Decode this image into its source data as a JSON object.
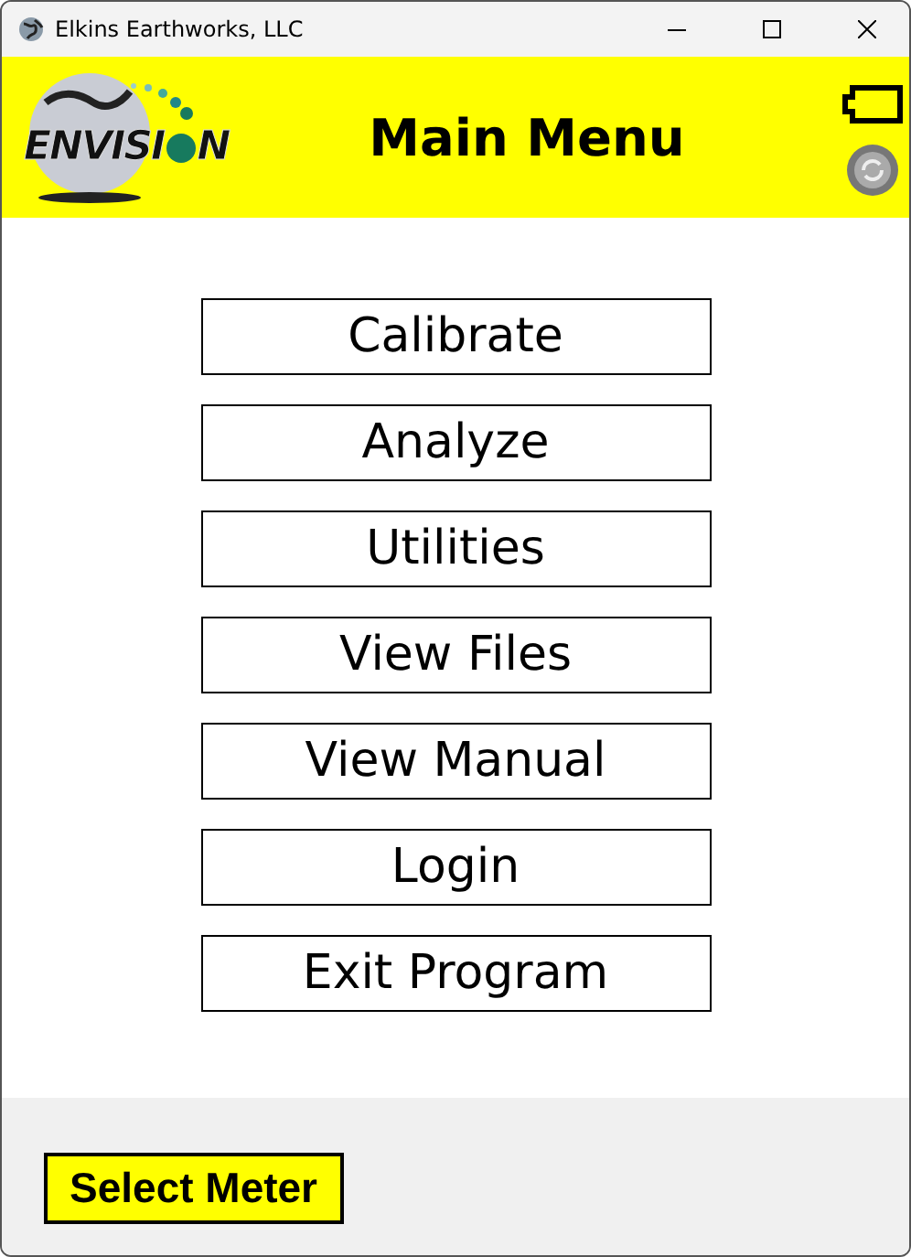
{
  "window": {
    "title": "Elkins Earthworks, LLC"
  },
  "header": {
    "logo": {
      "left": "ENVISI",
      "right": "N"
    },
    "title": "Main Menu"
  },
  "menu": [
    {
      "label": "Calibrate"
    },
    {
      "label": "Analyze"
    },
    {
      "label": "Utilities"
    },
    {
      "label": "View Files"
    },
    {
      "label": "View Manual"
    },
    {
      "label": "Login"
    },
    {
      "label": "Exit Program"
    }
  ],
  "footer": {
    "button": "Select Meter"
  }
}
